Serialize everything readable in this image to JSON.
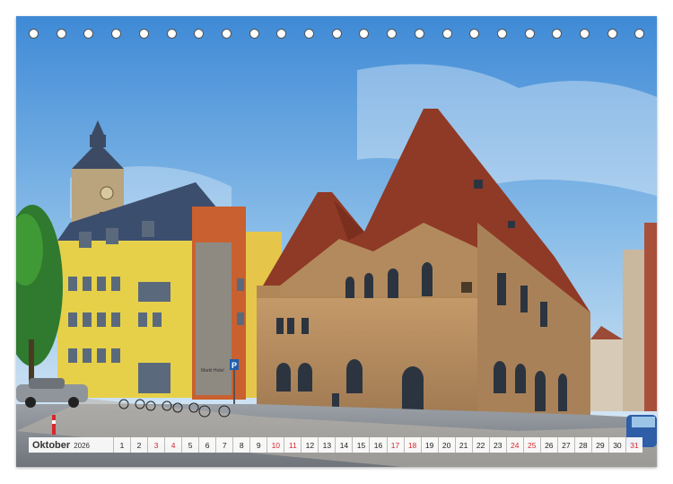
{
  "calendar": {
    "month": "Oktober",
    "year": "2026",
    "days": [
      {
        "n": "1",
        "h": false
      },
      {
        "n": "2",
        "h": false
      },
      {
        "n": "3",
        "h": true
      },
      {
        "n": "4",
        "h": true
      },
      {
        "n": "5",
        "h": false
      },
      {
        "n": "6",
        "h": false
      },
      {
        "n": "7",
        "h": false
      },
      {
        "n": "8",
        "h": false
      },
      {
        "n": "9",
        "h": false
      },
      {
        "n": "10",
        "h": true
      },
      {
        "n": "11",
        "h": true
      },
      {
        "n": "12",
        "h": false
      },
      {
        "n": "13",
        "h": false
      },
      {
        "n": "14",
        "h": false
      },
      {
        "n": "15",
        "h": false
      },
      {
        "n": "16",
        "h": false
      },
      {
        "n": "17",
        "h": true
      },
      {
        "n": "18",
        "h": true
      },
      {
        "n": "19",
        "h": false
      },
      {
        "n": "20",
        "h": false
      },
      {
        "n": "21",
        "h": false
      },
      {
        "n": "22",
        "h": false
      },
      {
        "n": "23",
        "h": false
      },
      {
        "n": "24",
        "h": true
      },
      {
        "n": "25",
        "h": true
      },
      {
        "n": "26",
        "h": false
      },
      {
        "n": "27",
        "h": false
      },
      {
        "n": "28",
        "h": false
      },
      {
        "n": "29",
        "h": false
      },
      {
        "n": "30",
        "h": false
      },
      {
        "n": "31",
        "h": true
      }
    ]
  },
  "sign": {
    "hotel": "Markt Hotel",
    "parking": "P"
  },
  "colors": {
    "holiday": "#d8262e",
    "sky": "#5ea2dc",
    "stone": "#b58a5c",
    "roof": "#8e3a26",
    "yellow": "#e6d04a"
  },
  "rings": 23
}
